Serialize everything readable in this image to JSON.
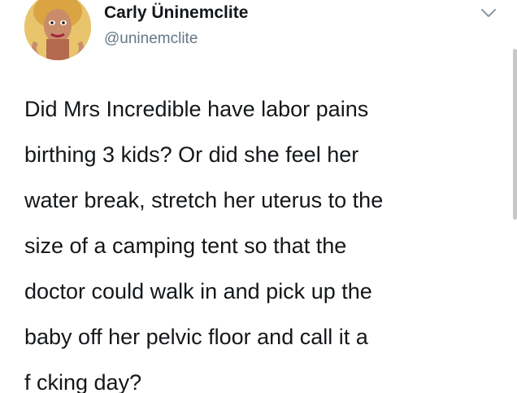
{
  "author": {
    "display_name": "Carly Üninemclite",
    "handle": "@uninemclite",
    "avatar_icon": "drag-queen-avatar"
  },
  "tweet": {
    "lines": [
      "Did Mrs Incredible have labor pains",
      "birthing 3 kids? Or did she feel her",
      "water break, stretch her uterus to the",
      "size of a camping tent so that the",
      "doctor could walk in and pick up the",
      "baby off her pelvic floor and call it a",
      "f  cking day?"
    ]
  },
  "icons": {
    "menu": "chevron-down-icon"
  },
  "colors": {
    "text": "#14171a",
    "secondary": "#657786",
    "background": "#ffffff"
  }
}
